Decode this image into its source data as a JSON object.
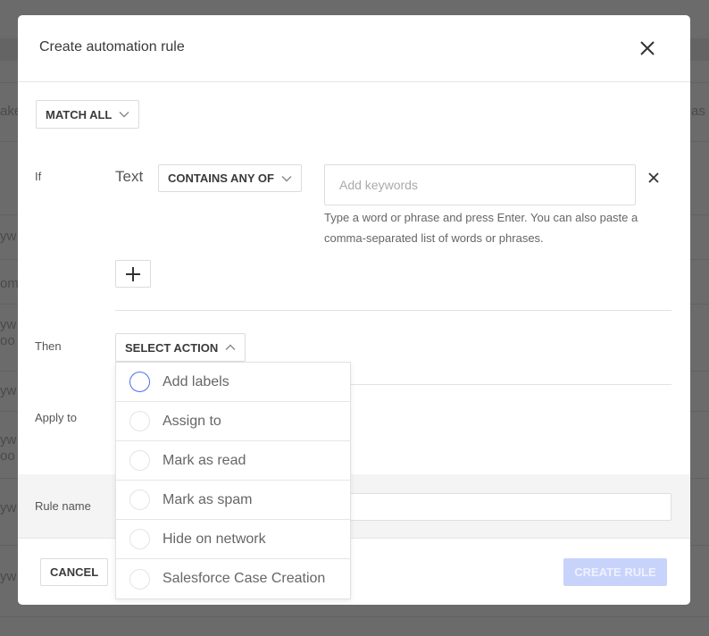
{
  "background": {
    "fragments": [
      "ake",
      "as",
      "yw",
      "om",
      "yw",
      "oo",
      "yw",
      "yw",
      "oo",
      "yw",
      "yw"
    ]
  },
  "modal": {
    "title": "Create automation rule",
    "close_icon": "close-icon",
    "match_mode": "MATCH ALL",
    "condition": {
      "if_label": "If",
      "field": "Text",
      "operator": "CONTAINS ANY OF",
      "keywords_value": "",
      "keywords_placeholder": "Add keywords",
      "help_text": "Type a word or phrase and press Enter. You can also paste a comma-separated list of words or phrases."
    },
    "then_label": "Then",
    "action_select": "SELECT ACTION",
    "actions": [
      {
        "label": "Add labels",
        "focused": true
      },
      {
        "label": "Assign to",
        "focused": false
      },
      {
        "label": "Mark as read",
        "focused": false
      },
      {
        "label": "Mark as spam",
        "focused": false
      },
      {
        "label": "Hide on network",
        "focused": false
      },
      {
        "label": "Salesforce Case Creation",
        "focused": false
      }
    ],
    "apply_to_label": "Apply to",
    "rule_name_label": "Rule name",
    "rule_name_value": "",
    "cancel_label": "CANCEL",
    "create_label": "CREATE RULE",
    "colors": {
      "primary_disabled": "#c8d3fc",
      "focus_ring": "#4d6ef0"
    }
  }
}
